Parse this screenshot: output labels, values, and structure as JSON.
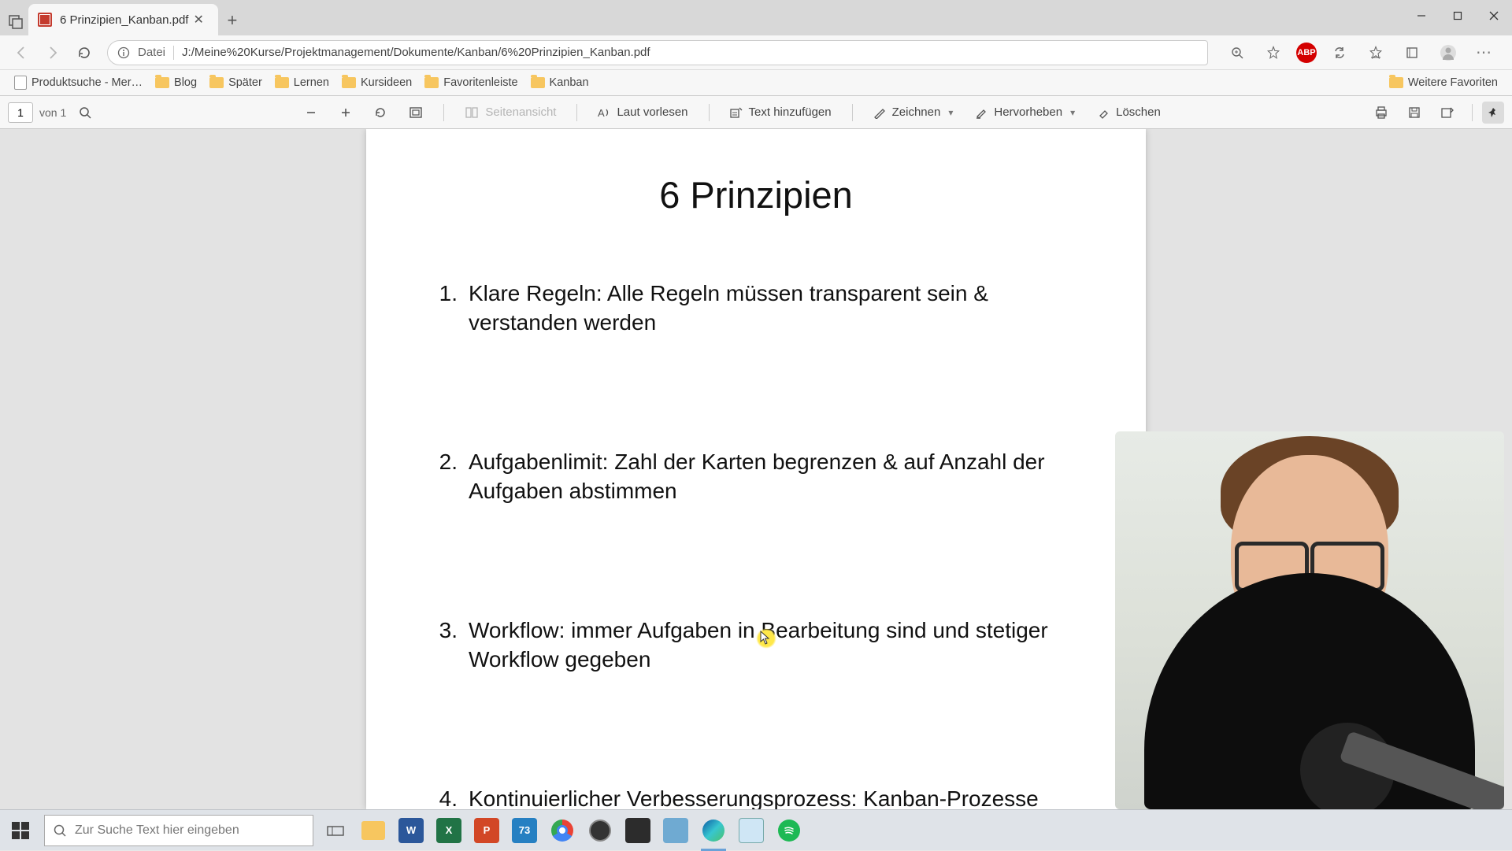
{
  "window": {
    "tab_title": "6 Prinzipien_Kanban.pdf"
  },
  "urlbar": {
    "protocol_label": "Datei",
    "path": "J:/Meine%20Kurse/Projektmanagement/Dokumente/Kanban/6%20Prinzipien_Kanban.pdf",
    "ext_badge": "ABP"
  },
  "bookmarks": {
    "items": [
      {
        "label": "Produktsuche - Mer…",
        "kind": "page"
      },
      {
        "label": "Blog",
        "kind": "folder"
      },
      {
        "label": "Später",
        "kind": "folder"
      },
      {
        "label": "Lernen",
        "kind": "folder"
      },
      {
        "label": "Kursideen",
        "kind": "folder"
      },
      {
        "label": "Favoritenleiste",
        "kind": "folder"
      },
      {
        "label": "Kanban",
        "kind": "folder"
      }
    ],
    "overflow": "Weitere Favoriten"
  },
  "pdfbar": {
    "page_current": "1",
    "page_total": "von 1",
    "page_view": "Seitenansicht",
    "read_aloud": "Laut vorlesen",
    "add_text": "Text hinzufügen",
    "draw": "Zeichnen",
    "highlight": "Hervorheben",
    "erase": "Löschen"
  },
  "document": {
    "title": "6 Prinzipien",
    "items": [
      {
        "n": "1.",
        "text": "Klare Regeln: Alle Regeln müssen transparent sein & verstanden werden"
      },
      {
        "n": "2.",
        "text": "Aufgabenlimit: Zahl der Karten begrenzen & auf Anzahl der Aufgaben abstimmen"
      },
      {
        "n": "3.",
        "text": "Workflow: immer Aufgaben in Bearbeitung sind und stetiger Workflow gegeben"
      },
      {
        "n": "4.",
        "text": "Kontinuierlicher Verbesserungsprozess: Kanban-Prozesse regelmäßig analysieren"
      }
    ]
  },
  "taskbar": {
    "search_placeholder": "Zur Suche Text hier eingeben",
    "apps": [
      {
        "name": "explorer",
        "color": "#f7c65f",
        "label": ""
      },
      {
        "name": "word",
        "color": "#2b579a",
        "label": "W"
      },
      {
        "name": "excel",
        "color": "#217346",
        "label": "X"
      },
      {
        "name": "powerpoint",
        "color": "#d24726",
        "label": "P"
      },
      {
        "name": "eclipse",
        "color": "#2680c2",
        "label": "73"
      },
      {
        "name": "chrome",
        "color": "#ffffff",
        "label": ""
      },
      {
        "name": "obs",
        "color": "#333333",
        "label": ""
      },
      {
        "name": "app1",
        "color": "#2c2c2c",
        "label": ""
      },
      {
        "name": "app2",
        "color": "#6faad2",
        "label": ""
      },
      {
        "name": "edge",
        "color": "#37a6d0",
        "label": ""
      },
      {
        "name": "notepad",
        "color": "#cfe6f5",
        "label": ""
      },
      {
        "name": "spotify",
        "color": "#1db954",
        "label": ""
      }
    ]
  }
}
